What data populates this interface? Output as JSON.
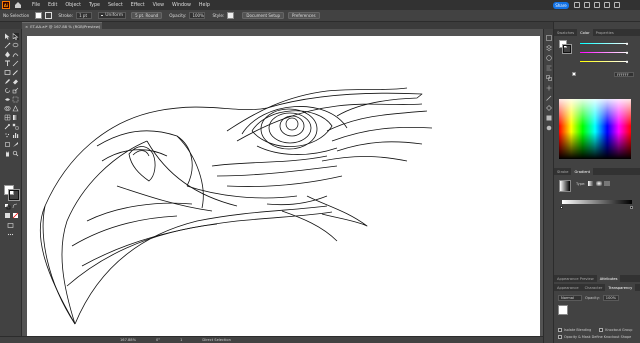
{
  "app": {
    "logo_text": "Ai",
    "menu": [
      "File",
      "Edit",
      "Object",
      "Type",
      "Select",
      "Effect",
      "View",
      "Window",
      "Help"
    ],
    "share_label": "Share"
  },
  "controlbar": {
    "selection_label": "No Selection",
    "stroke_label": "Stroke:",
    "stroke_value": "1 pt",
    "brush_label": "Uniform",
    "brush_size": "5 pt. Round",
    "opacity_label": "Opacity:",
    "opacity_value": "100%",
    "style_label": "Style:",
    "doc_setup_label": "Document Setup",
    "preferences_label": "Preferences"
  },
  "document": {
    "tab_title": "ET-AA.ai* @ 167.88 % (RGB/Preview)",
    "close_glyph": "×"
  },
  "statusbar": {
    "zoom": "167.88%",
    "angle": "0°",
    "artboard": "1",
    "tool": "Direct Selection"
  },
  "panels": {
    "top_tabs": [
      "Swatches",
      "Color",
      "Properties"
    ],
    "active_top_tab": "Color",
    "color_hex": "FFFFFF",
    "stroke_tab": "Stroke",
    "gradient_tab": "Gradient",
    "gradient_type_label": "Type:",
    "lower_tabs": [
      "Appearance Preview",
      "Attributes"
    ],
    "lower_tabs2": [
      "Appearance",
      "Character",
      "Transparency"
    ],
    "blend_mode": "Normal",
    "opacity_label": "Opacity:",
    "opacity_value": "100%",
    "isolate_blending": "Isolate Blending",
    "knockout_group": "Knockout Group",
    "opacity_mask_label": "Opacity & Mask Define Knockout Shape"
  },
  "colors": {
    "menubar_bg": "#323232",
    "panel_bg": "#424242",
    "canvas_bg": "#535353",
    "artboard": "#ffffff",
    "accent": "#1473e6",
    "app_orange": "#ff9a00"
  },
  "icons": [
    "home-icon",
    "selection-tool-icon",
    "direct-selection-icon",
    "pen-icon",
    "type-icon",
    "line-icon",
    "rectangle-icon",
    "brush-icon",
    "pencil-icon",
    "eraser-icon",
    "rotate-icon",
    "scale-icon",
    "width-icon",
    "shape-builder-icon",
    "gradient-icon",
    "eyedropper-icon",
    "blend-icon",
    "hand-icon",
    "zoom-icon"
  ]
}
